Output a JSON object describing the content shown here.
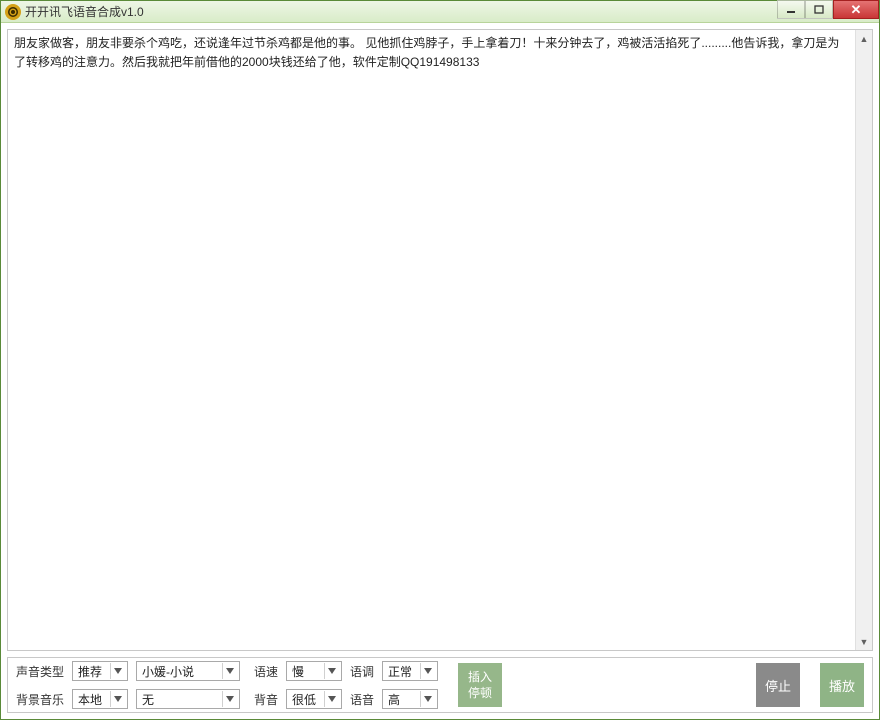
{
  "window": {
    "title": "开开讯飞语音合成v1.0"
  },
  "text_content": "朋友家做客，朋友非要杀个鸡吃，还说逢年过节杀鸡都是他的事。 见他抓住鸡脖子，手上拿着刀！十来分钟去了，鸡被活活掐死了.........他告诉我，拿刀是为了转移鸡的注意力。然后我就把年前借他的2000块钱还给了他，软件定制QQ191498133",
  "labels": {
    "voice_type": "声音类型",
    "bg_music": "背景音乐",
    "speed": "语速",
    "bg_vol": "背音",
    "pitch": "语调",
    "voice_vol": "语音"
  },
  "combos": {
    "voice_type": "推荐",
    "voice": "小媛-小说",
    "bg_src": "本地",
    "bg_track": "无",
    "speed": "慢",
    "bg_vol": "很低",
    "pitch": "正常",
    "voice_vol": "高"
  },
  "buttons": {
    "insert_line1": "插入",
    "insert_line2": "停顿",
    "stop": "停止",
    "play": "播放"
  }
}
